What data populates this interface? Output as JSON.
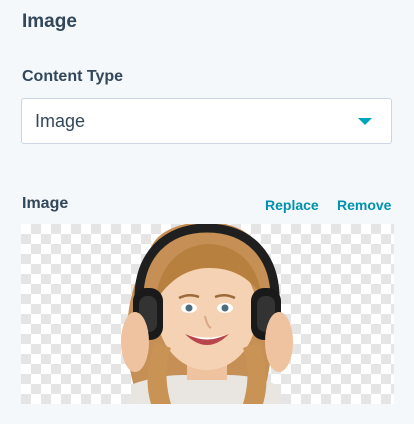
{
  "panel": {
    "title": "Image"
  },
  "content_type": {
    "label": "Content Type",
    "value": "Image",
    "caret_icon": "caret-down-icon"
  },
  "image": {
    "label": "Image",
    "replace_label": "Replace",
    "remove_label": "Remove",
    "preview_icon": "image-preview"
  },
  "colors": {
    "background": "#f5f8fa",
    "text": "#33475b",
    "accent": "#00a4bd",
    "link": "#0091ae",
    "border": "#cbd6e2"
  }
}
